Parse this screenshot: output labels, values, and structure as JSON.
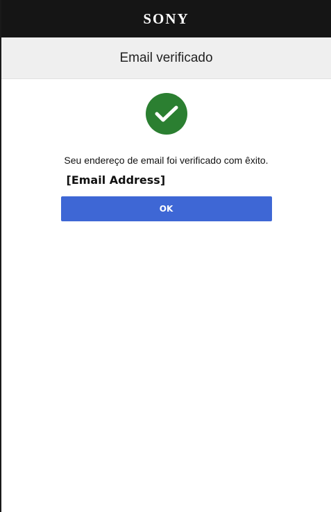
{
  "header": {
    "brand": "SONY",
    "title": "Email verificado"
  },
  "status": {
    "icon": "checkmark-circle-icon",
    "color": "#2b7f31",
    "message": "Seu endereço de email foi verificado com êxito.",
    "email": "[Email Address]"
  },
  "actions": {
    "ok_label": "OK",
    "button_color": "#3e67d5"
  }
}
